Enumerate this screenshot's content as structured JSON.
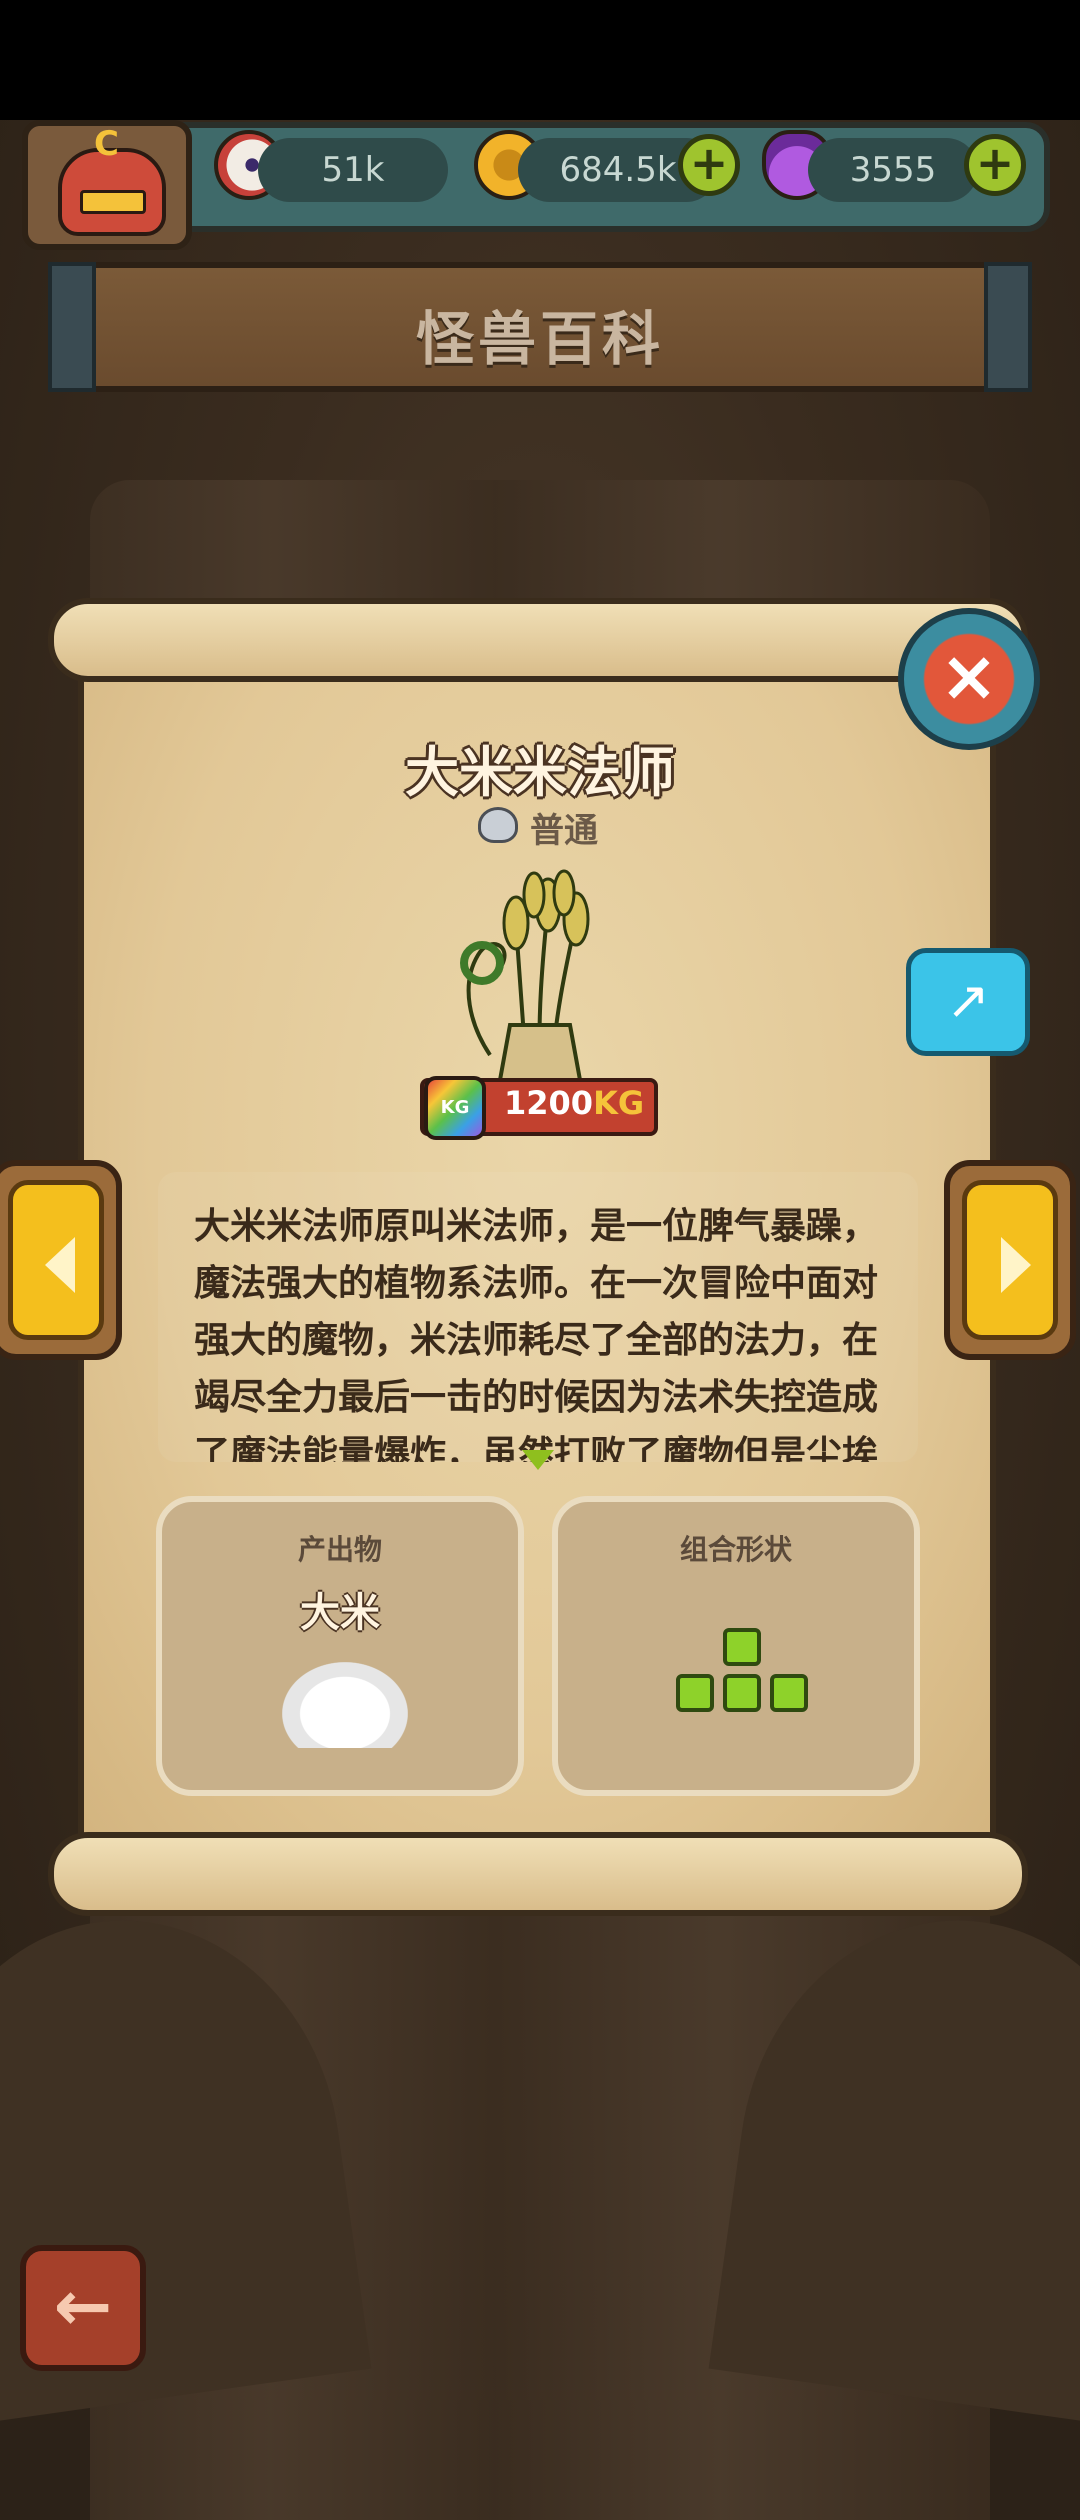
{
  "resources": {
    "eyes": "51k",
    "coins": "684.5k",
    "potions": "3555"
  },
  "avatar": {
    "letter": "C"
  },
  "page_title": "怪兽百科",
  "monster": {
    "name": "大米米法师",
    "rarity": "普通",
    "weight_value": "1200",
    "weight_unit": "KG",
    "weight_tag": "KG",
    "description": "大米米法师原叫米法师，是一位脾气暴躁，魔法强大的植物系法师。在一次冒险中面对强大的魔物，米法师耗尽了全部的法力，在竭尽全力最后一击的时候因为法术失控造成了魔法能量爆炸，虽然打败了魔物但是尘埃落定之后，米法师也付出了代价，变成了一棵水稻"
  },
  "cards": {
    "output_title": "产出物",
    "output_value": "大米",
    "shape_title": "组合形状"
  },
  "icons": {
    "close": "×",
    "share": "↗",
    "back": "←",
    "plus": "+"
  },
  "colors": {
    "accent_yellow": "#f4bf1d",
    "block_green": "#8ed22a",
    "close_red": "#e2573a",
    "share_cyan": "#3bc4e8"
  }
}
